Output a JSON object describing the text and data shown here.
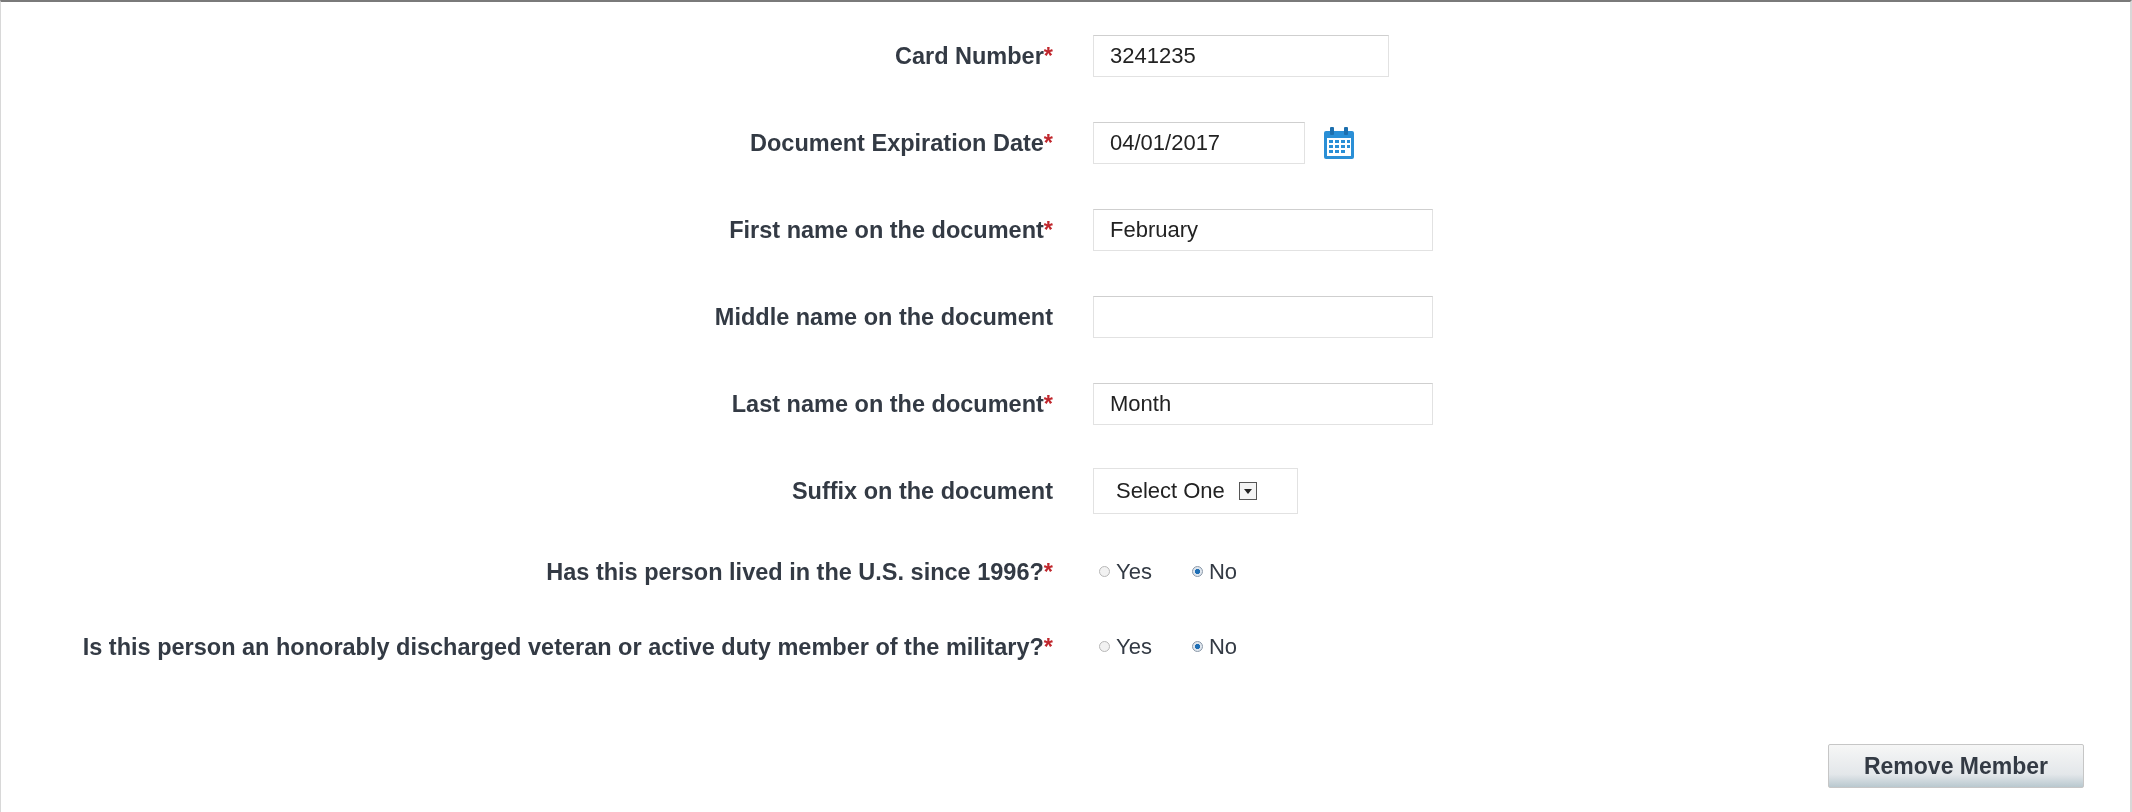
{
  "fields": [
    {
      "kind": "text",
      "label": "Card Number",
      "required_mark": "*",
      "value": "3241235"
    },
    {
      "kind": "date",
      "label": "Document Expiration Date",
      "required_mark": "*",
      "value": "04/01/2017"
    },
    {
      "kind": "text",
      "label": "First name on the document",
      "required_mark": "*",
      "value": "February"
    },
    {
      "kind": "text",
      "label": "Middle name on the document"
    },
    {
      "kind": "text",
      "label": "Last name on the document",
      "required_mark": "*",
      "value": "Month"
    },
    {
      "kind": "select",
      "label": "Suffix on the document",
      "value": "Select One"
    },
    {
      "kind": "radio",
      "label": "Has this person lived in the U.S. since 1996?",
      "required_mark": "*",
      "options": [
        {
          "label": "Yes",
          "selected": false
        },
        {
          "label": "No",
          "selected": true
        }
      ]
    },
    {
      "kind": "radio",
      "label": "Is this person an honorably discharged veteran or active duty member of the military?",
      "required_mark": "*",
      "options": [
        {
          "label": "Yes",
          "selected": false
        },
        {
          "label": "No",
          "selected": true
        }
      ]
    }
  ],
  "remove_button": "Remove Member"
}
